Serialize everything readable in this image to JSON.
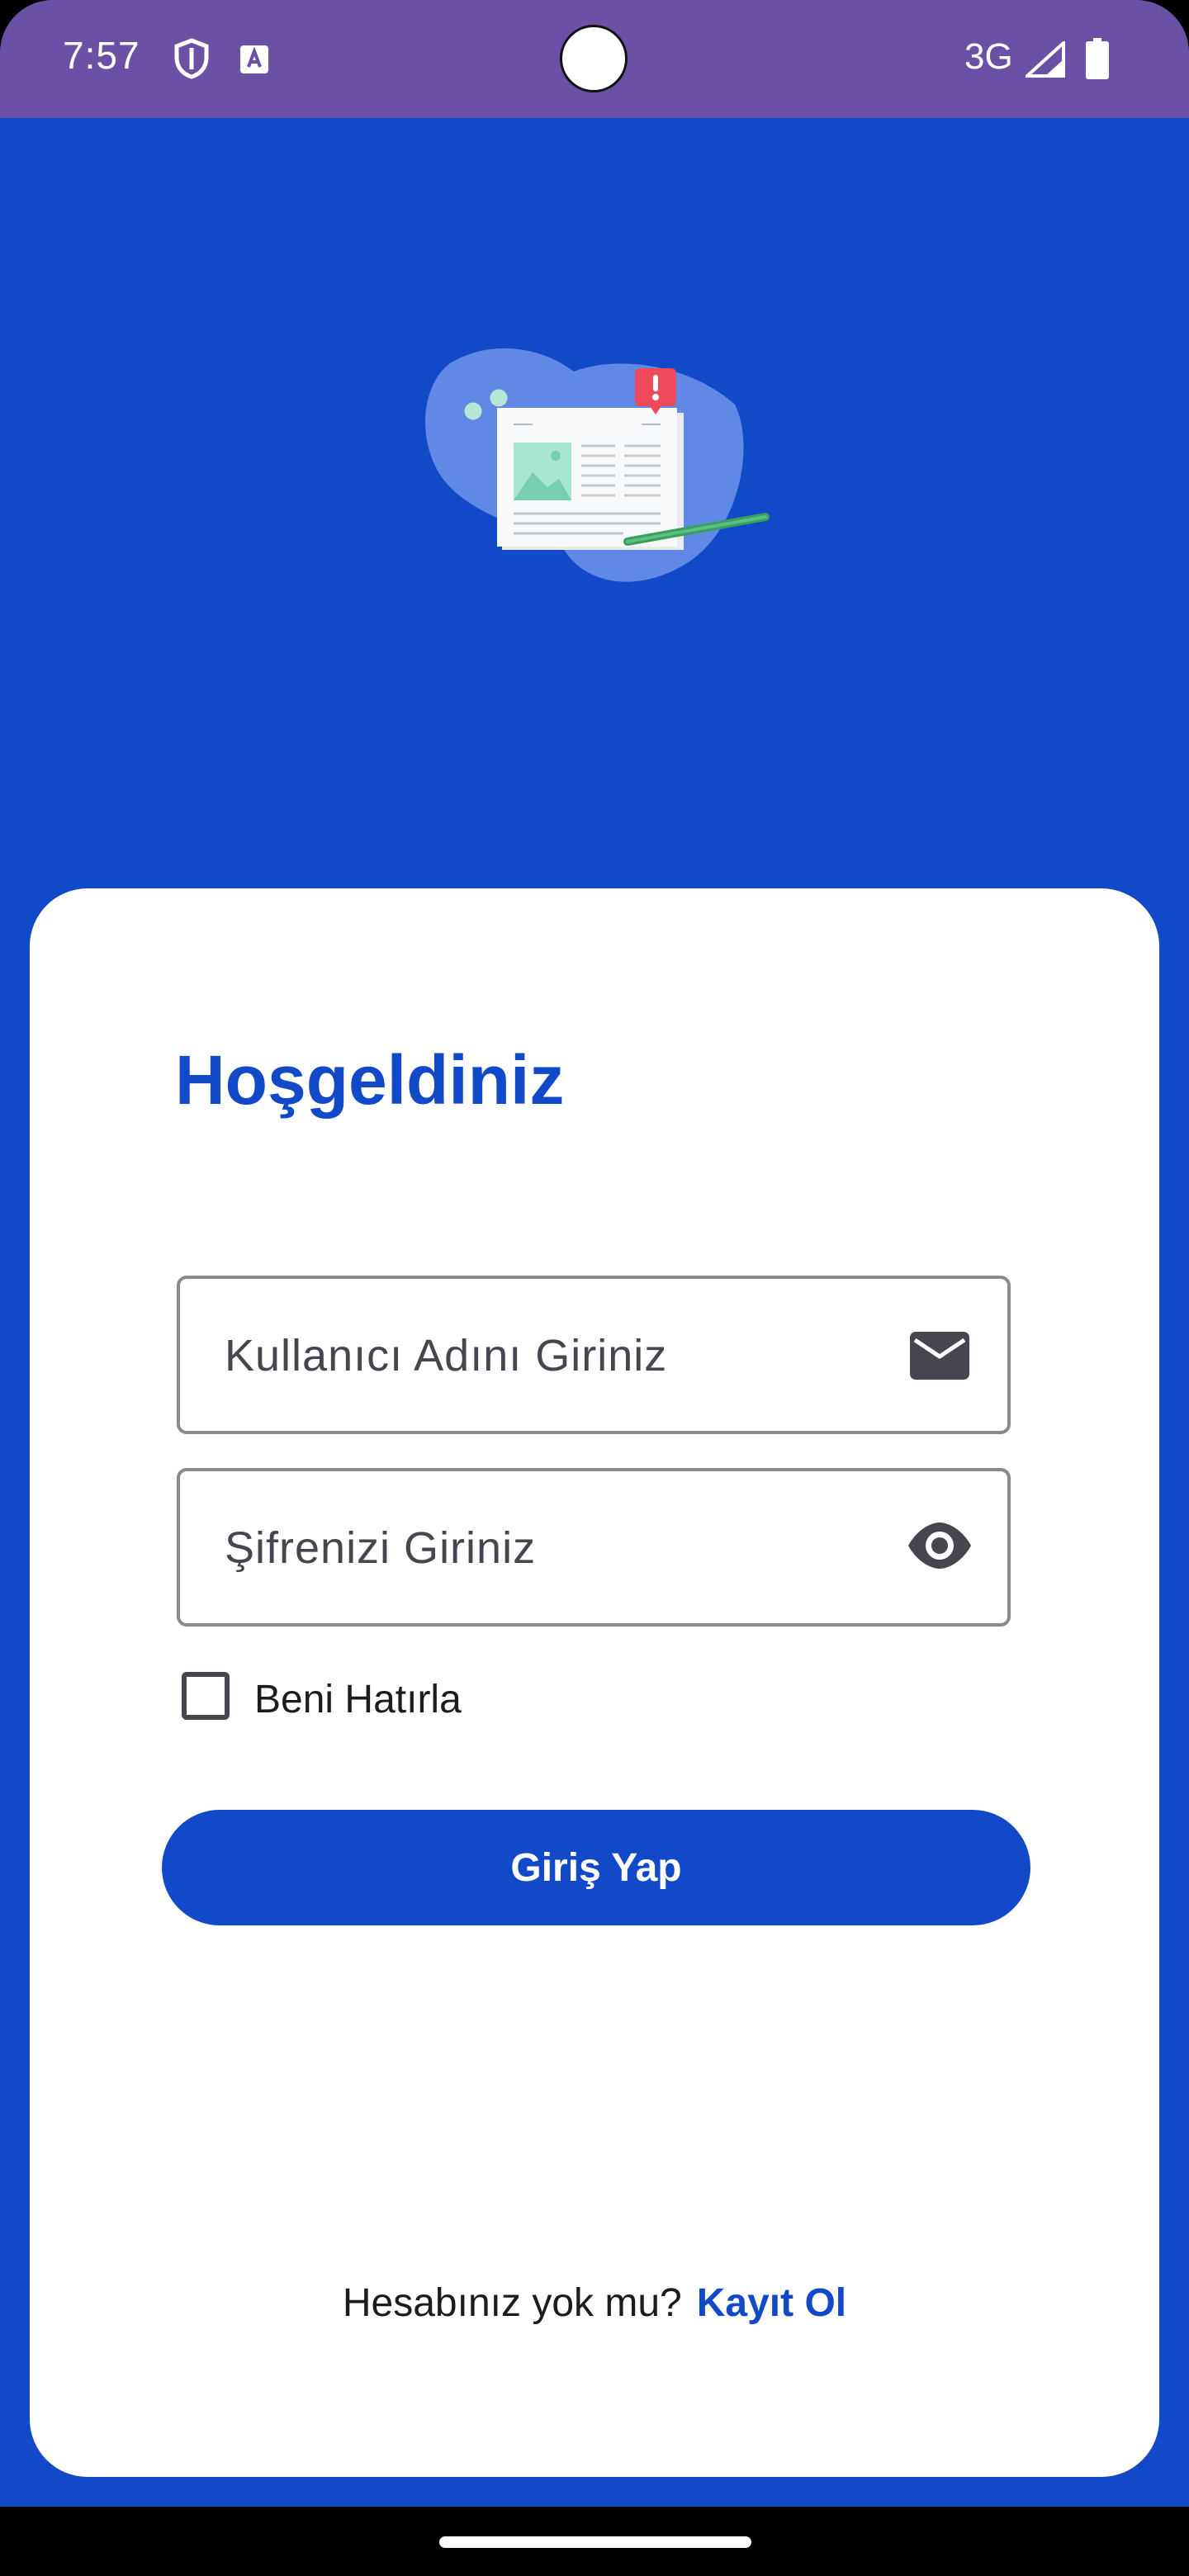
{
  "status_bar": {
    "time": "7:57",
    "network": "3G",
    "icons": [
      "shield-icon",
      "keyboard-a-icon",
      "signal-icon",
      "battery-icon"
    ],
    "background": "#6a51a6"
  },
  "illustration": {
    "icon": "newsletter-document-illustration"
  },
  "login_card": {
    "title": "Hoşgeldiniz",
    "username": {
      "placeholder": "Kullanıcı Adını Giriniz",
      "value": "",
      "icon": "mail-icon"
    },
    "password": {
      "placeholder": "Şifrenizi Giriniz",
      "value": "",
      "icon": "eye-icon"
    },
    "remember_me": {
      "label": "Beni Hatırla",
      "checked": false
    },
    "login_button": "Giriş Yap",
    "register": {
      "question": "Hesabınız yok mu?",
      "link": "Kayıt Ol"
    }
  },
  "colors": {
    "primary": "#1249c8",
    "card": "#ffffff",
    "text": "#1c1b1f"
  }
}
